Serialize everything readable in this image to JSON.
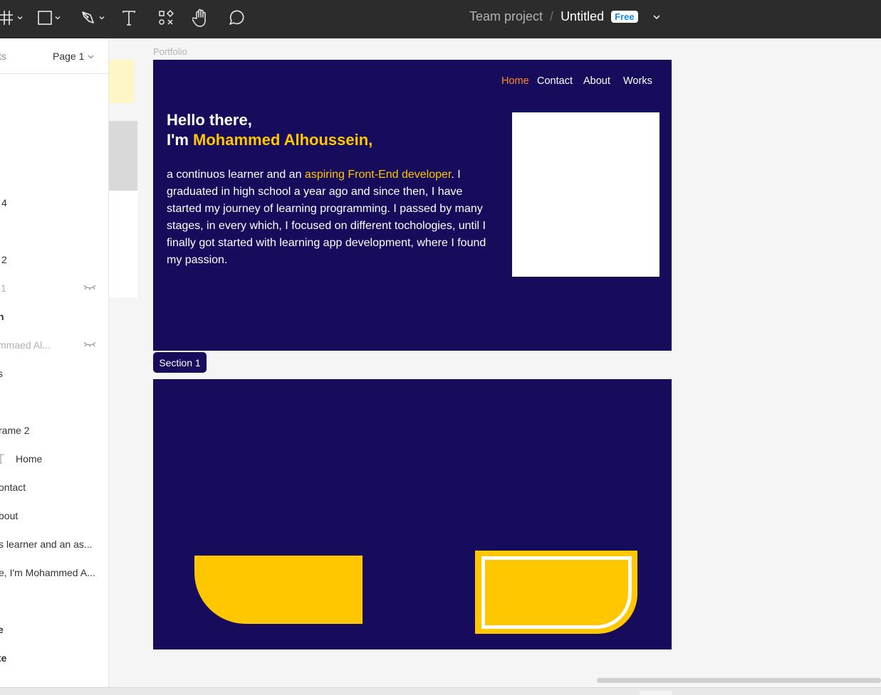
{
  "toolbar": {
    "tools": [
      "frame-tool",
      "rectangle-tool",
      "pen-tool",
      "text-tool",
      "components-tool",
      "hand-tool",
      "comment-tool"
    ],
    "project": "Team project",
    "separator": "/",
    "file": "Untitled",
    "badge": "Free"
  },
  "panel": {
    "header_left": "ts",
    "page": "Page 1",
    "layers": [
      "4",
      "2",
      "1",
      "n",
      "mmaed Al...",
      "s",
      "rame 2",
      "Home",
      "ontact",
      "bout",
      "s learner and an as...",
      "e, I'm Mohammed A...",
      "e",
      "te"
    ]
  },
  "canvas": {
    "frame_label": "Portfolio",
    "nav": {
      "home": "Home",
      "contact": "Contact",
      "about": "About",
      "works": "Works"
    },
    "hero": {
      "line1": "Hello there,",
      "line2_prefix": "I'm ",
      "name": "Mohammed Alhoussein,",
      "bio_prefix": " a continuos learner and an ",
      "bio_highlight": "aspiring Front-End developer",
      "bio_rest": ". I graduated in high school a year ago and since then, I have started my journey of learning programming. I passed by many stages, in every which, I focused on different tochologies, until I finally got started with learning app development, where I found my passion."
    },
    "section_tag": "Section 1"
  },
  "colors": {
    "toolbar": "#2c2c2c",
    "frame": "#170b5b",
    "accent": "#ffc700",
    "nav_active": "#ff8a2a",
    "badge_text": "#0d8ce9"
  }
}
